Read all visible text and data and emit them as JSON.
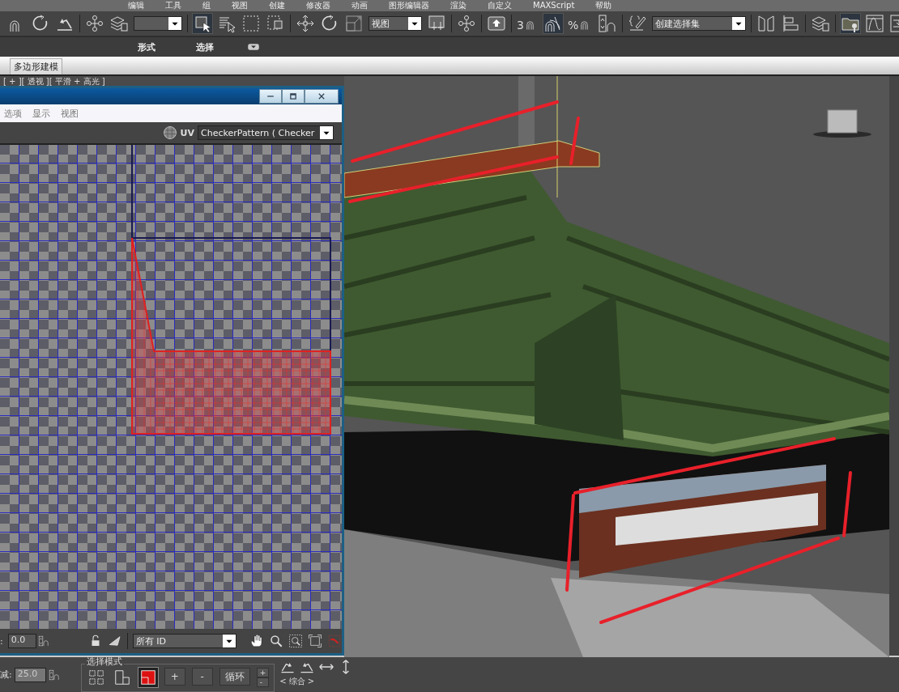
{
  "menu_bar": [
    "编辑",
    "工具",
    "组",
    "视图",
    "创建",
    "修改器",
    "动画",
    "图形编辑器",
    "渲染",
    "自定义",
    "MAXScript",
    "帮助"
  ],
  "main_toolbar": {
    "reference_dropdown": "视图",
    "snap_labels": [
      "3",
      "%"
    ],
    "selection_set_dropdown": "创建选择集"
  },
  "ribbon_tabs": [
    {
      "label": "形式",
      "selected": false
    },
    {
      "label": "选择",
      "selected": false
    }
  ],
  "ribbon_panel": {
    "label": "多边形建模"
  },
  "viewport": {
    "label": "[ + ][ 透视 ][ 平滑 + 高光 ]"
  },
  "uv_editor": {
    "menu": [
      "选项",
      "显示",
      "视图"
    ],
    "channel_label": "UV",
    "texture_dropdown": "CheckerPattern  ( Checker",
    "value_label": ":",
    "value": "0.0",
    "id_dropdown": "所有 ID"
  },
  "bottom_panel": {
    "falloff_label": "减:",
    "falloff_value": "25.0",
    "group_title": "选择模式",
    "selection_modes": [
      {
        "selected": false
      },
      {
        "selected": false
      },
      {
        "selected": true
      }
    ],
    "buttons": [
      "+",
      "-",
      "循环"
    ],
    "spinner": [
      "+",
      "-"
    ],
    "loop_label": "综合",
    "loop_prev": "<",
    "loop_next": ">"
  }
}
